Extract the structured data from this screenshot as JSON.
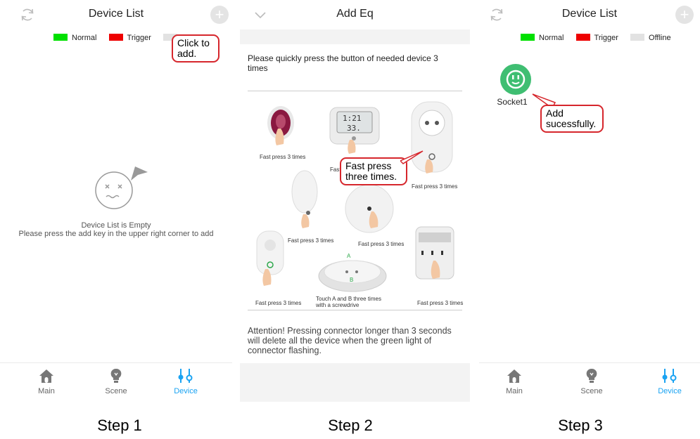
{
  "steps": [
    "Step 1",
    "Step 2",
    "Step 3"
  ],
  "panel1": {
    "title": "Device List",
    "legend": {
      "normal": "Normal",
      "trigger": "Trigger"
    },
    "callout": "Click to add.",
    "empty_title": "Device List is Empty",
    "empty_hint": "Please press the add key in the upper right corner to add"
  },
  "panel2": {
    "title": "Add Eq",
    "instruction": "Please quickly press the button of needed device 3 times",
    "callout": "Fast press three times.",
    "labels": {
      "fast1": "Fast press 3 times",
      "fast2": "Fast",
      "fast3": "Fast press 3 times",
      "fast4": "Fast press 3 times",
      "fast5": "Fast press 3 times",
      "fast6": "Fast press 3 times",
      "fast7": "Fast press 3 times",
      "touch": "Touch A and B three times with a screwdrive",
      "mark_a": "A",
      "mark_b": "B",
      "clock_top": "1:21",
      "clock_bottom": "33."
    },
    "attention": "Attention! Pressing connector longer than 3 seconds will delete all the device when the green light of connector flashing."
  },
  "panel3": {
    "title": "Device List",
    "legend": {
      "normal": "Normal",
      "trigger": "Trigger",
      "offline": "Offline"
    },
    "device_name": "Socket1",
    "callout": "Add sucessfully."
  },
  "tabs": {
    "main": "Main",
    "scene": "Scene",
    "device": "Device"
  },
  "colors": {
    "normal": "#00e000",
    "trigger": "#ee0000",
    "offline": "#e2e2e2",
    "accent": "#1aa3f2",
    "callout_border": "#d6262c",
    "device_green": "#3fbe72"
  }
}
